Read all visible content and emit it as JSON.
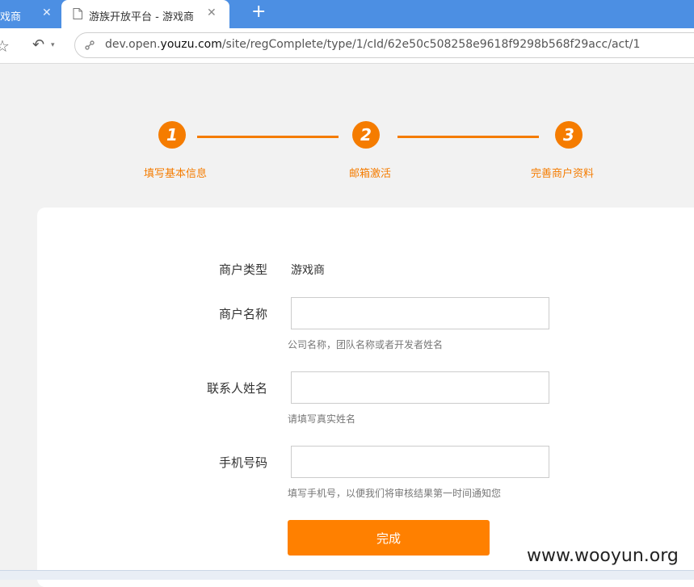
{
  "browser": {
    "tabs": [
      {
        "label": "戏商",
        "active": false
      },
      {
        "label": "游族开放平台 - 游戏商",
        "active": true
      }
    ],
    "new_tab_symbol": "+",
    "close_symbol": "✕",
    "url": {
      "scheme": "dev.open.",
      "host": "youzu.com",
      "path": "/site/regComplete/type/1/cId/62e50c508258e9618f9298b568f29acc/act/1"
    },
    "icons": [
      "star-icon",
      "undo-icon",
      "page-icon",
      "security-icon"
    ]
  },
  "steps": [
    {
      "number": "1",
      "label": "填写基本信息"
    },
    {
      "number": "2",
      "label": "邮箱激活"
    },
    {
      "number": "3",
      "label": "完善商户资料"
    }
  ],
  "form": {
    "merchant_type": {
      "label": "商户类型",
      "value": "游戏商"
    },
    "merchant_name": {
      "label": "商户名称",
      "value": "",
      "hint": "公司名称，团队名称或者开发者姓名"
    },
    "contact_name": {
      "label": "联系人姓名",
      "value": "",
      "hint": "请填写真实姓名"
    },
    "phone": {
      "label": "手机号码",
      "value": "",
      "hint": "填写手机号，以便我们将审核结果第一时间通知您"
    },
    "submit_label": "完成"
  },
  "watermark": "www.wooyun.org",
  "colors": {
    "accent": "#f57c00",
    "button": "#ff8000",
    "tabbar": "#4c8fe3",
    "page_bg": "#f2f2f2"
  }
}
